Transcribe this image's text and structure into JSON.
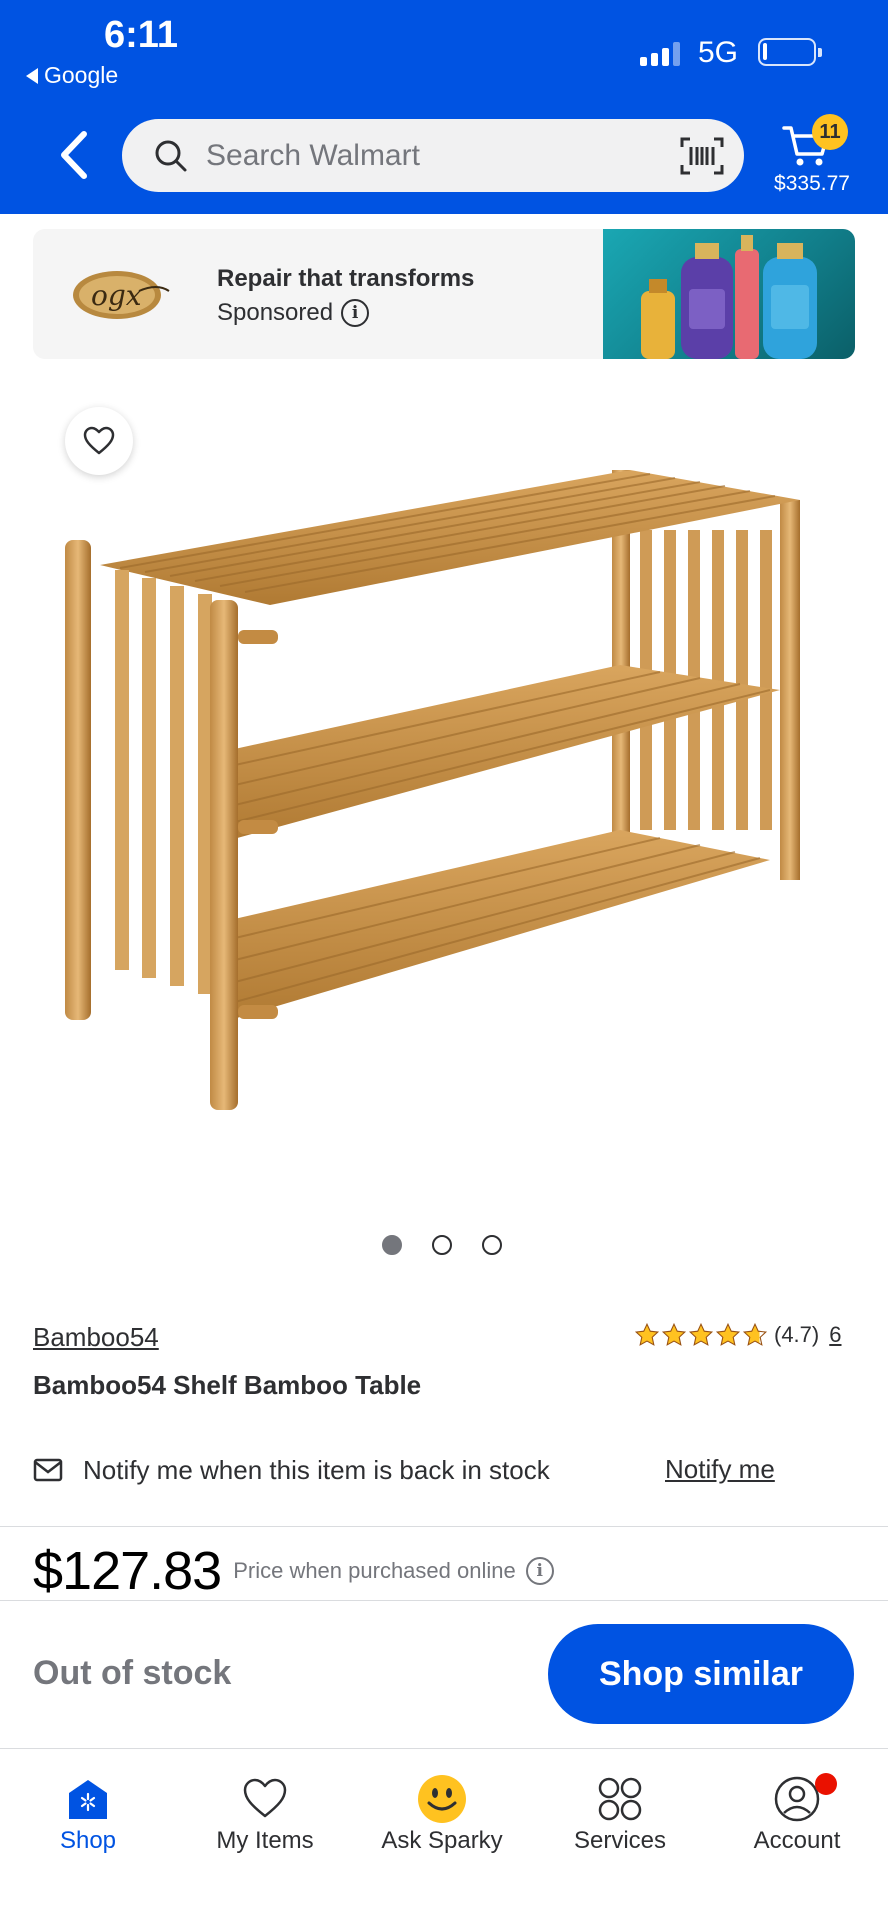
{
  "status_bar": {
    "time": "6:11",
    "back_app": "Google",
    "network": "5G"
  },
  "header": {
    "search_placeholder": "Search Walmart",
    "cart_count": "11",
    "cart_total": "$335.77",
    "colors": {
      "brand_blue": "#0053e2",
      "spark_yellow": "#ffc220"
    }
  },
  "ad": {
    "brand_logo": "ogx",
    "title": "Repair that transforms",
    "sponsored_label": "Sponsored"
  },
  "product": {
    "image_count": 3,
    "active_image": 1,
    "brand": "Bamboo54",
    "rating": "(4.7)",
    "rating_value": 4.7,
    "review_count": "6",
    "title": "Bamboo54 Shelf Bamboo Table",
    "notify_text": "Notify me when this item is back in stock",
    "notify_link": "Notify me",
    "price": "$127.83",
    "price_note": "Price when purchased online",
    "stock_status": "Out of stock",
    "cta": "Shop similar"
  },
  "bottom_nav": [
    {
      "label": "Shop",
      "icon": "shop-icon",
      "active": true
    },
    {
      "label": "My Items",
      "icon": "heart-icon",
      "active": false
    },
    {
      "label": "Ask Sparky",
      "icon": "sparky-icon",
      "active": false
    },
    {
      "label": "Services",
      "icon": "services-icon",
      "active": false
    },
    {
      "label": "Account",
      "icon": "account-icon",
      "active": false
    }
  ]
}
